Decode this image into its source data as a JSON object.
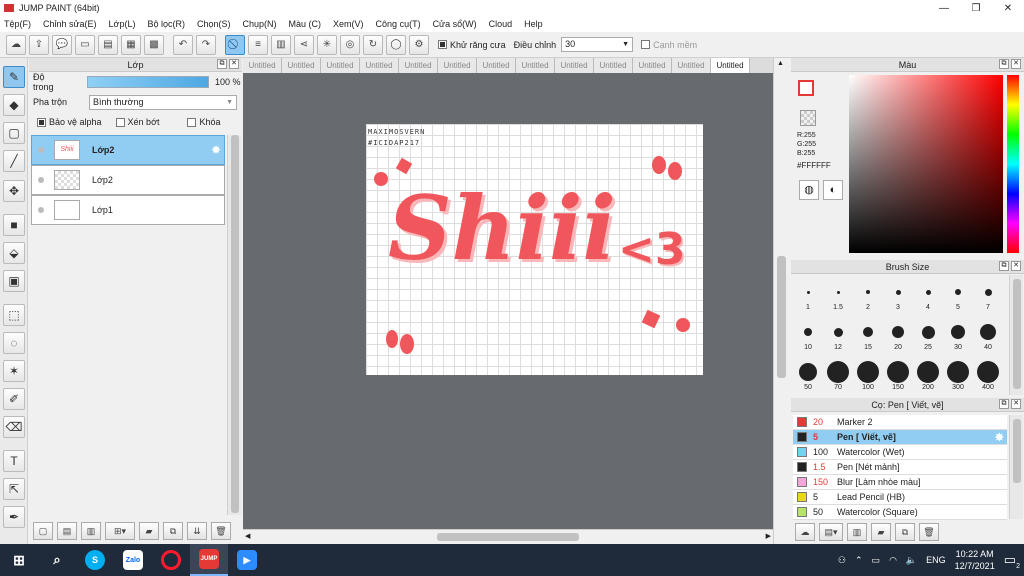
{
  "window": {
    "title": "JUMP PAINT (64bit)",
    "min": "—",
    "max": "❐",
    "close": "✕"
  },
  "menu": [
    "Tệp(F)",
    "Chỉnh sửa(E)",
    "Lớp(L)",
    "Bộ lọc(R)",
    "Chọn(S)",
    "Chụp(N)",
    "Màu (C)",
    "Xem(V)",
    "Công cụ(T)",
    "Cửa sổ(W)",
    "Cloud",
    "Help"
  ],
  "toolbar": {
    "antialias_label": "Khử răng cưa",
    "adjust_label": "Điều chỉnh",
    "adjust_value": "30",
    "smooth_label": "Cạnh mềm"
  },
  "layer_panel": {
    "title": "Lớp",
    "opacity_label": "Độ trong",
    "opacity_value": "100 %",
    "blend_label": "Pha trộn",
    "blend_value": "Bình thường",
    "protect_alpha": "Bảo vệ alpha",
    "clipping": "Xén bớt",
    "lock": "Khóa",
    "layers": [
      {
        "name": "Lớp2",
        "thumb_text": "Shiii"
      },
      {
        "name": "Lớp2"
      },
      {
        "name": "Lớp1"
      }
    ]
  },
  "tabs": [
    "Untitled",
    "Untitled",
    "Untitled",
    "Untitled",
    "Untitled",
    "Untitled",
    "Untitled",
    "Untitled",
    "Untitled",
    "Untitled",
    "Untitled",
    "Untitled",
    "Untitled"
  ],
  "artwork": {
    "main_text": "Shiii",
    "suffix": "<3",
    "credit1": "MAXIMOSVERN",
    "credit2": "#ICIDAP217"
  },
  "color_panel": {
    "title": "Màu",
    "r": "R:255",
    "g": "G:255",
    "b": "B:255",
    "hex": "#FFFFFF"
  },
  "brush_size_panel": {
    "title": "Brush Size",
    "sizes": [
      "1",
      "1.5",
      "2",
      "3",
      "4",
      "5",
      "7",
      "10",
      "12",
      "15",
      "20",
      "25",
      "30",
      "40",
      "50",
      "70",
      "100",
      "150",
      "200",
      "300",
      "400"
    ]
  },
  "brush_list": {
    "title": "Cọ: Pen [ Viết, vẽ]",
    "items": [
      {
        "size": "20",
        "name": "Marker 2",
        "color": "#e53935"
      },
      {
        "size": "5",
        "name": "Pen [ Viết, vẽ]",
        "color": "#222222"
      },
      {
        "size": "100",
        "name": "Watercolor (Wet)",
        "color": "#6fd4f0"
      },
      {
        "size": "1.5",
        "name": "Pen [Nét mảnh]",
        "color": "#222222"
      },
      {
        "size": "150",
        "name": "Blur [Làm nhòe màu]",
        "color": "#f3a7d8"
      },
      {
        "size": "5",
        "name": "Lead Pencil (HB)",
        "color": "#e8d71c"
      },
      {
        "size": "50",
        "name": "Watercolor (Square)",
        "color": "#b7e36b"
      }
    ]
  },
  "taskbar": {
    "lang": "ENG",
    "time": "10:22 AM",
    "date": "12/7/2021",
    "notif_count": "2"
  },
  "colors": {
    "accent": "#3c8ccc",
    "selection": "#91cdf2",
    "art_pink": "#f0575c"
  }
}
